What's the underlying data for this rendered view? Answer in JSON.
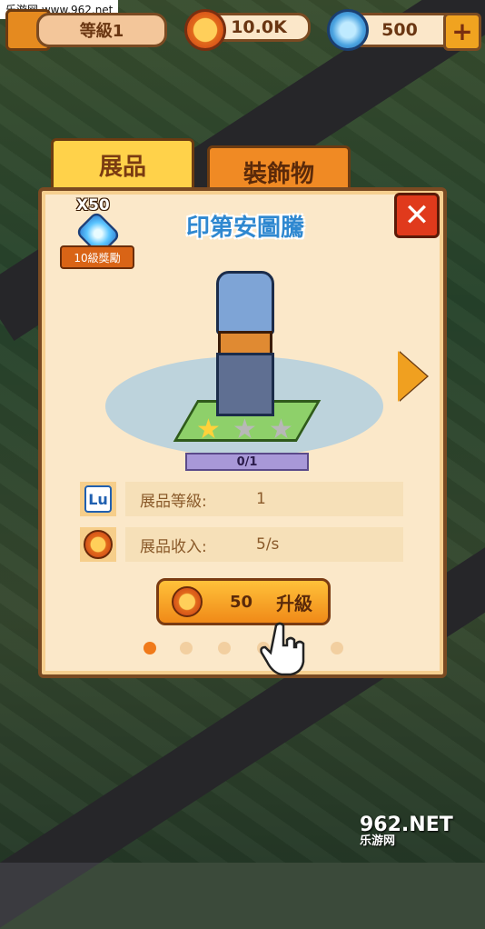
{
  "header": {
    "level_label": "等級1",
    "coins": "10.0K",
    "gems": "500",
    "plus_symbol": "+"
  },
  "watermark": {
    "top": "乐游网 www.962.net",
    "bottom_main": "962.NET",
    "bottom_sub": "乐游网"
  },
  "tabs": [
    {
      "label": "展品",
      "active": true
    },
    {
      "label": "裝飾物",
      "active": false
    }
  ],
  "panel": {
    "reward_count": "X50",
    "reward_label": "10級獎勵",
    "item_title": "印第安圖騰",
    "close_symbol": "✕",
    "progress_text": "0/1",
    "stars_filled": 1,
    "stars_total": 3,
    "stats": [
      {
        "icon": "level-icon",
        "icon_text": "Lu",
        "label": "展品等級:",
        "value": "1"
      },
      {
        "icon": "coin-icon",
        "label": "展品收入:",
        "value": "5/s"
      }
    ],
    "upgrade": {
      "cost": "50",
      "label": "升級"
    },
    "page_dots": 5,
    "active_dot": 0
  }
}
